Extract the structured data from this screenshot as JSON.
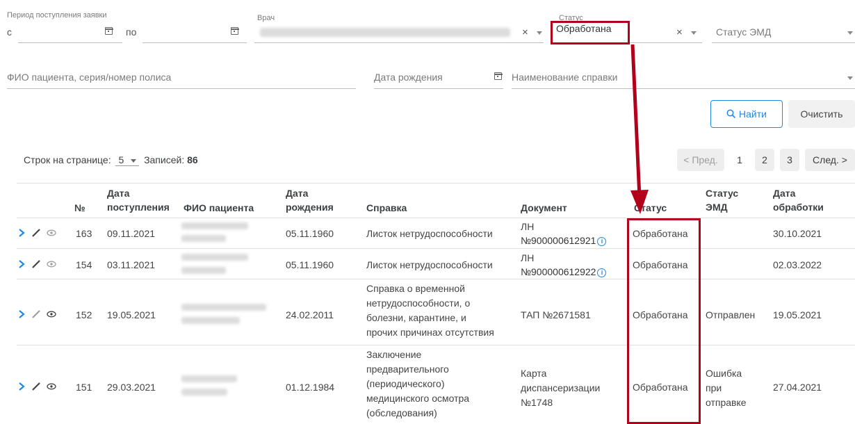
{
  "filters": {
    "period_label": "Период поступления заявки",
    "from_label": "с",
    "to_label": "по",
    "doctor_label": "Врач",
    "status_label": "Статус",
    "status_value": "Обработана",
    "emd_status_placeholder": "Статус ЭМД",
    "patient_placeholder": "ФИО пациента, серия/номер полиса",
    "birthdate_placeholder": "Дата рождения",
    "certificate_placeholder": "Наименование справки"
  },
  "actions": {
    "find_label": "Найти",
    "clear_label": "Очистить"
  },
  "pager": {
    "rows_label": "Строк на странице:",
    "rows_value": "5",
    "records_label": "Записей:",
    "records_value": "86",
    "prev_label": "< Пред.",
    "pages": [
      "1",
      "2",
      "3"
    ],
    "next_label": "След. >"
  },
  "table": {
    "headers": {
      "num": "№",
      "date_in_1": "Дата",
      "date_in_2": "поступления",
      "patient": "ФИО пациента",
      "birth_1": "Дата",
      "birth_2": "рождения",
      "certificate": "Справка",
      "document": "Документ",
      "status": "Статус",
      "emd_1": "Статус",
      "emd_2": "ЭМД",
      "processed_1": "Дата",
      "processed_2": "обработки"
    },
    "rows": [
      {
        "num": "163",
        "date_in": "09.11.2021",
        "birth": "05.11.1960",
        "certificate": [
          "Листок нетрудоспособности"
        ],
        "document": [
          "ЛН",
          "№900000612921"
        ],
        "status": "Обработана",
        "emd": [],
        "processed": "30.10.2021"
      },
      {
        "num": "154",
        "date_in": "03.11.2021",
        "birth": "05.11.1960",
        "certificate": [
          "Листок нетрудоспособности"
        ],
        "document": [
          "ЛН",
          "№900000612922"
        ],
        "status": "Обработана",
        "emd": [],
        "processed": "02.03.2022"
      },
      {
        "num": "152",
        "date_in": "19.05.2021",
        "birth": "24.02.2011",
        "certificate": [
          "Справка о временной",
          "нетрудоспособности, о",
          "болезни, карантине, и",
          "прочих причинах отсутствия"
        ],
        "document": [
          "ТАП №2671581"
        ],
        "status": "Обработана",
        "emd": [
          "Отправлен"
        ],
        "processed": "19.05.2021"
      },
      {
        "num": "151",
        "date_in": "29.03.2021",
        "birth": "01.12.1984",
        "certificate": [
          "Заключение",
          "предварительного",
          "(периодического)",
          "медицинского осмотра",
          "(обследования)"
        ],
        "document": [
          "Карта",
          "диспансеризации",
          "№1748"
        ],
        "status": "Обработана",
        "emd": [
          "Ошибка",
          "при",
          "отправке"
        ],
        "processed": "27.04.2021"
      }
    ]
  },
  "colors": {
    "accent": "#1e88e5",
    "highlight": "#b3001b"
  }
}
